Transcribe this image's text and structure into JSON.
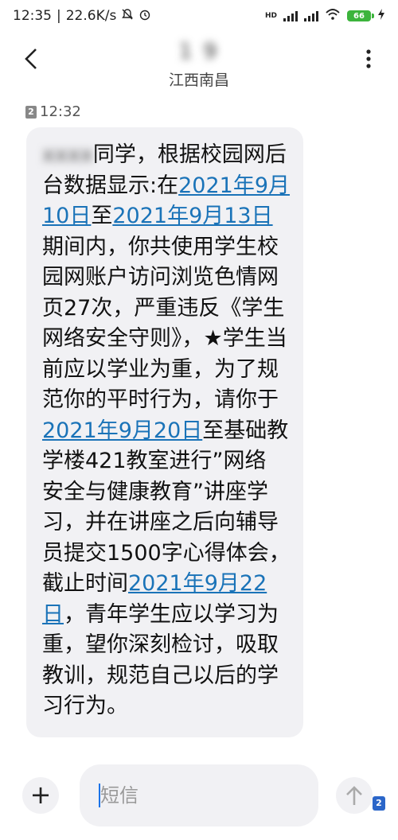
{
  "status_bar": {
    "time": "12:35",
    "net_speed": "22.6K/s",
    "mute_icon": "bell-off-icon",
    "alarm_icon": "alarm-icon",
    "hd_label": "HD",
    "battery": "66"
  },
  "header": {
    "contact_name": "1   9",
    "location": "江西南昌"
  },
  "message": {
    "sim_slot": "2",
    "time": "12:32",
    "blurred_name": "xxxx",
    "parts": [
      "同学，根据校园网后台数据显示:在",
      "2021年9月10日",
      "至",
      "2021年9月13日",
      "期间内，你共使用学生校园网账户访问浏览色情网页27次，严重违反《学生网络安全守则》，★学生当前应以学业为重，为了规范你的平时行为，请你于",
      "2021年9月20日",
      "至基础教学楼421教室进行”网络 安全与健康教育”讲座学习，并在讲座之后向辅导员提交1500字心得体会，截止时间",
      "2021年9月22日",
      "，青年学生应以学习为重，望你深刻检讨，吸取教训，规范自己以后的学习行为。"
    ]
  },
  "input_bar": {
    "placeholder": "短信",
    "sim_slot": "2"
  },
  "colors": {
    "link": "#1a73b8",
    "bubble": "#f1f1f4",
    "battery": "#3cb43c"
  }
}
